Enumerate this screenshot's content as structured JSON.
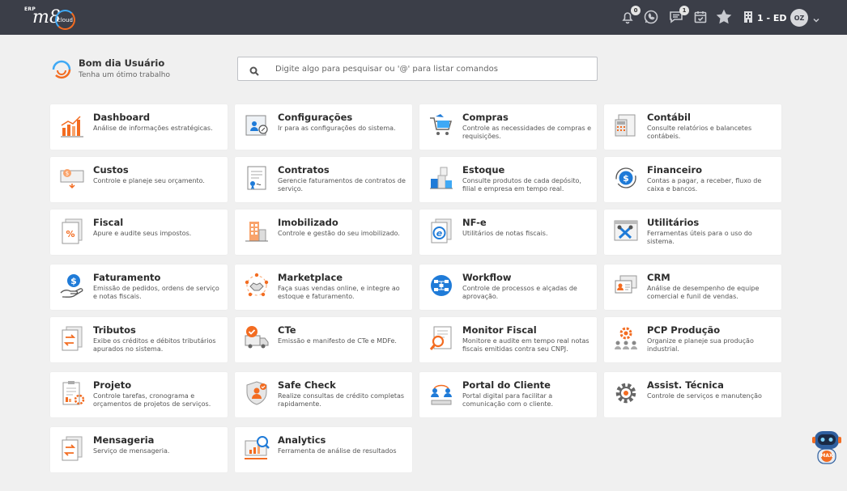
{
  "topbar": {
    "logo": {
      "erp": "ERP",
      "m8": "m8",
      "cloud": "cloud"
    },
    "notifications": {
      "icon": "bell-icon",
      "count": "0"
    },
    "whatsapp": {
      "icon": "whatsapp-icon"
    },
    "messages": {
      "icon": "chat-icon",
      "count": "1"
    },
    "calendar": {
      "icon": "calendar-check-icon"
    },
    "favorites": {
      "icon": "star-icon"
    },
    "company": {
      "icon": "building-icon",
      "label": "1 - ED"
    },
    "user": {
      "initials": "OZ"
    }
  },
  "greeting": {
    "title": "Bom dia Usuário",
    "subtitle": "Tenha um ótimo trabalho"
  },
  "search": {
    "placeholder": "Digite algo para pesquisar ou '@' para listar comandos"
  },
  "modules": [
    {
      "title": "Dashboard",
      "desc": "Análise de informações estratégicas.",
      "icon": "bar-chart-icon"
    },
    {
      "title": "Configurações",
      "desc": "Ir para as configurações do sistema.",
      "icon": "settings-profile-icon"
    },
    {
      "title": "Compras",
      "desc": "Controle as necessidades de compras e requisições.",
      "icon": "shopping-cart-icon"
    },
    {
      "title": "Contábil",
      "desc": "Consulte relatórios e balancetes contábeis.",
      "icon": "calculator-document-icon"
    },
    {
      "title": "Custos",
      "desc": "Controle e planeje seu orçamento.",
      "icon": "cost-money-icon"
    },
    {
      "title": "Contratos",
      "desc": "Gerencie faturamentos de contratos de serviço.",
      "icon": "contract-icon"
    },
    {
      "title": "Estoque",
      "desc": "Consulte produtos de cada depósito, filial e empresa em tempo real.",
      "icon": "boxes-icon"
    },
    {
      "title": "Financeiro",
      "desc": "Contas a pagar, a receber, fluxo de caixa e bancos.",
      "icon": "dollar-cycle-icon"
    },
    {
      "title": "Fiscal",
      "desc": "Apure e audite seus impostos.",
      "icon": "percent-document-icon"
    },
    {
      "title": "Imobilizado",
      "desc": "Controle e gestão do seu imobilizado.",
      "icon": "building-asset-icon"
    },
    {
      "title": "NF-e",
      "desc": "Utilitários de notas fiscais.",
      "icon": "nfe-document-icon"
    },
    {
      "title": "Utilitários",
      "desc": "Ferramentas úteis para o uso do sistema.",
      "icon": "tools-icon"
    },
    {
      "title": "Faturamento",
      "desc": "Emissão de pedidos, ordens de serviço e notas fiscais.",
      "icon": "hand-dollar-icon"
    },
    {
      "title": "Marketplace",
      "desc": "Faça suas vendas online, e integre ao estoque e faturamento.",
      "icon": "handshake-icon"
    },
    {
      "title": "Workflow",
      "desc": "Controle de processos e alçadas de aprovação.",
      "icon": "workflow-icon"
    },
    {
      "title": "CRM",
      "desc": "Análise de desempenho de equipe comercial e funil de vendas.",
      "icon": "crm-cards-icon"
    },
    {
      "title": "Tributos",
      "desc": "Exibe os créditos e débitos tributários apurados no sistema.",
      "icon": "exchange-document-icon"
    },
    {
      "title": "CTe",
      "desc": "Emissão e manifesto de CTe e MDFe.",
      "icon": "truck-check-icon"
    },
    {
      "title": "Monitor Fiscal",
      "desc": "Monitore e audite em tempo real notas fiscais emitidas contra seu CNPJ.",
      "icon": "magnifier-document-icon"
    },
    {
      "title": "PCP Produção",
      "desc": "Organize e planeje sua produção industrial.",
      "icon": "production-gear-icon"
    },
    {
      "title": "Projeto",
      "desc": "Controle tarefas, cronograma e orçamentos de projetos de serviços.",
      "icon": "project-clipboard-icon"
    },
    {
      "title": "Safe Check",
      "desc": "Realize consultas de crédito completas rapidamente.",
      "icon": "shield-user-icon"
    },
    {
      "title": "Portal do Cliente",
      "desc": "Portal digital para facilitar a comunicação com o cliente.",
      "icon": "customer-portal-icon"
    },
    {
      "title": "Assist. Técnica",
      "desc": "Controle de serviços e manutenção",
      "icon": "gear-icon"
    },
    {
      "title": "Mensageria",
      "desc": "Serviço de mensageria.",
      "icon": "message-exchange-icon"
    },
    {
      "title": "Analytics",
      "desc": "Ferramenta de análise de resultados",
      "icon": "analytics-board-icon"
    }
  ],
  "assistant": {
    "icon": "robot-assistant-icon",
    "label": "MAX"
  },
  "colors": {
    "topbar": "#3b3e48",
    "accent_orange": "#f36c21",
    "accent_blue": "#1f7bd8",
    "background": "#f0f0f0"
  }
}
